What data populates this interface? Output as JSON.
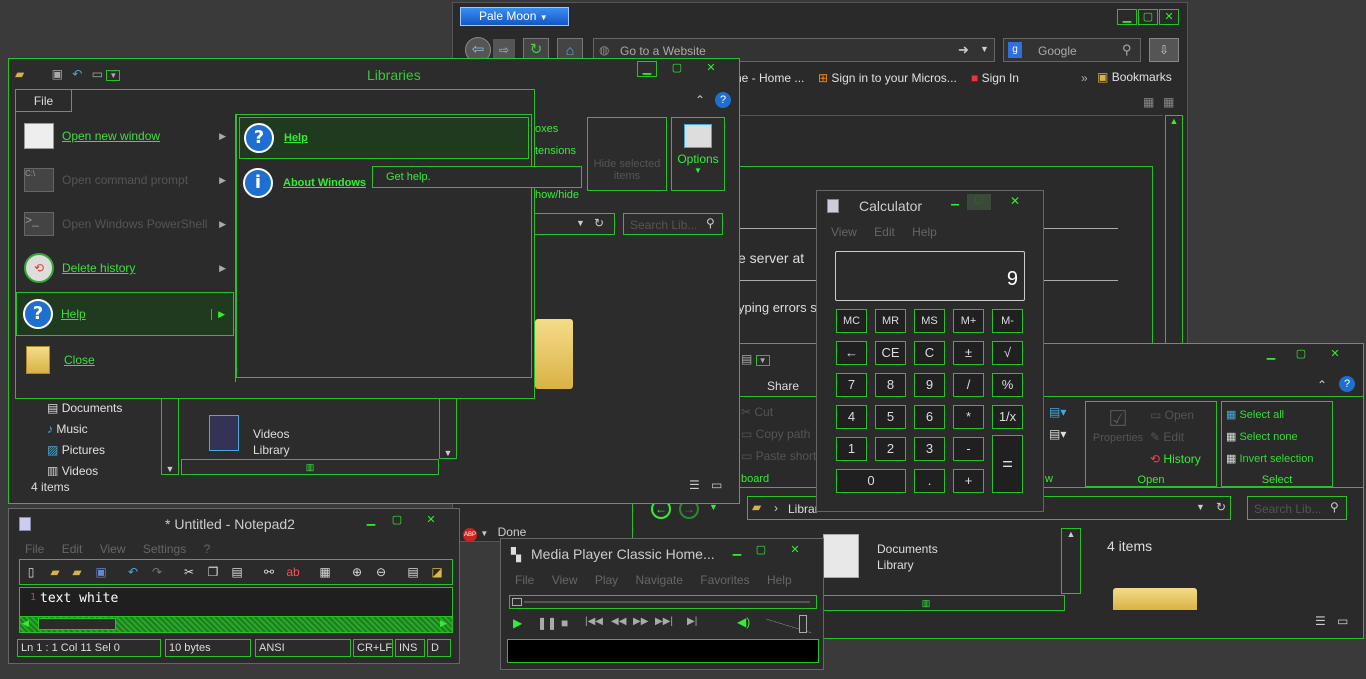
{
  "palemoon": {
    "app_button": "Pale Moon",
    "address_placeholder": "Go to a Website",
    "search_engine": "Google",
    "bookmarks": [
      "ne - Home ...",
      "Sign in to your Micros...",
      "Sign In"
    ],
    "bookmarks_menu": "Bookmarks",
    "page_fragments": [
      "e server at",
      "yping errors s"
    ],
    "status": "Done"
  },
  "libraries": {
    "title": "Libraries",
    "file_tab": "File",
    "menu": [
      {
        "label": "Open new window",
        "enabled": true
      },
      {
        "label": "Open command prompt",
        "enabled": false
      },
      {
        "label": "Open Windows PowerShell",
        "enabled": false
      },
      {
        "label": "Delete history",
        "enabled": true
      },
      {
        "label": "Help",
        "enabled": true
      },
      {
        "label": "Close",
        "enabled": true
      }
    ],
    "submenu": [
      "Help",
      "About Windows"
    ],
    "tooltip": "Get help.",
    "ribbon_fragments": [
      "oxes",
      "tensions",
      "how/hide"
    ],
    "hide_selected": "Hide selected items",
    "options": "Options",
    "search_placeholder": "Search Lib...",
    "nav": [
      "Documents",
      "Music",
      "Pictures",
      "Videos"
    ],
    "videos_item": [
      "Videos",
      "Library"
    ],
    "status": "4 items"
  },
  "calculator": {
    "title": "Calculator",
    "menu": [
      "View",
      "Edit",
      "Help"
    ],
    "display": "9",
    "rows": [
      [
        "MC",
        "MR",
        "MS",
        "M+",
        "M-"
      ],
      [
        "←",
        "CE",
        "C",
        "±",
        "√"
      ],
      [
        "7",
        "8",
        "9",
        "/",
        "%"
      ],
      [
        "4",
        "5",
        "6",
        "*",
        "1/x"
      ],
      [
        "1",
        "2",
        "3",
        "-"
      ],
      [
        "0",
        ".",
        "+"
      ]
    ],
    "equals": "="
  },
  "explorer2": {
    "share_tab": "Share",
    "clipboard": [
      "Cut",
      "Copy path",
      "Paste shortcut"
    ],
    "clipboard_frag": "board",
    "new_frag": "w",
    "properties": "Properties",
    "open_items": [
      "Open",
      "Edit",
      "History"
    ],
    "open_group": "Open",
    "select_items": [
      "Select all",
      "Select none",
      "Invert selection"
    ],
    "select_group": "Select",
    "breadcrumb": "Librar",
    "search_placeholder": "Search Lib...",
    "documents_item": [
      "Documents",
      "Library"
    ],
    "detail_status": "4 items"
  },
  "notepad": {
    "title": "* Untitled - Notepad2",
    "menu": [
      "File",
      "Edit",
      "View",
      "Settings",
      "?"
    ],
    "line_no": "1",
    "text": "text white",
    "status": [
      "Ln 1 : 1   Col 11   Sel 0",
      "10 bytes",
      "ANSI",
      "CR+LF",
      "INS",
      "D"
    ]
  },
  "mpc": {
    "title": "Media Player Classic Home...",
    "menu": [
      "File",
      "View",
      "Play",
      "Navigate",
      "Favorites",
      "Help"
    ]
  },
  "colors": {
    "accent": "#27c227",
    "bg": "#2b2b2b",
    "desktop": "#3a3a3a",
    "highlight_text": "#33dd33"
  }
}
